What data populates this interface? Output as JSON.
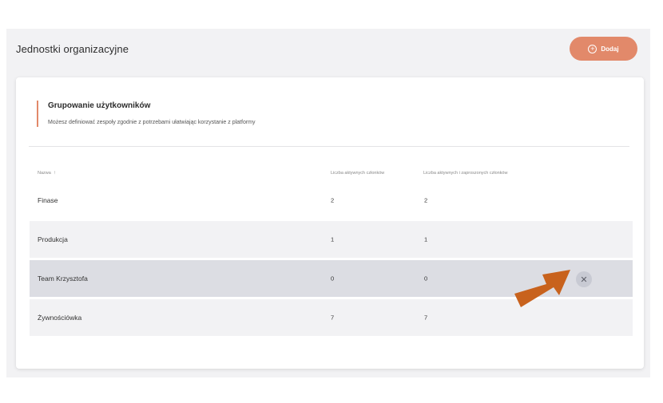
{
  "header": {
    "title": "Jednostki organizacyjne",
    "add_label": "Dodaj",
    "add_icon": "plus-circle-icon"
  },
  "section": {
    "title": "Grupowanie użytkowników",
    "description": "Możesz definiować zespoły zgodnie z potrzebami ułatwiając korzystanie z platformy"
  },
  "table": {
    "columns": {
      "name": "Nazwa",
      "active": "Liczba aktywnych członków",
      "invited": "Liczba aktywnych i zaproszonych członków"
    },
    "sort_icon": "arrow-up-icon",
    "rows": [
      {
        "name": "Finase",
        "active": "2",
        "invited": "2"
      },
      {
        "name": "Produkcja",
        "active": "1",
        "invited": "1"
      },
      {
        "name": "Team Krzysztofa",
        "active": "0",
        "invited": "0"
      },
      {
        "name": "Żywnościówka",
        "active": "7",
        "invited": "7"
      }
    ],
    "remove_icon": "close-icon"
  },
  "colors": {
    "accent": "#e2896a",
    "annotation_arrow": "#c8621d",
    "row_alt": "#f2f2f4",
    "row_hover": "#dcdde3"
  }
}
